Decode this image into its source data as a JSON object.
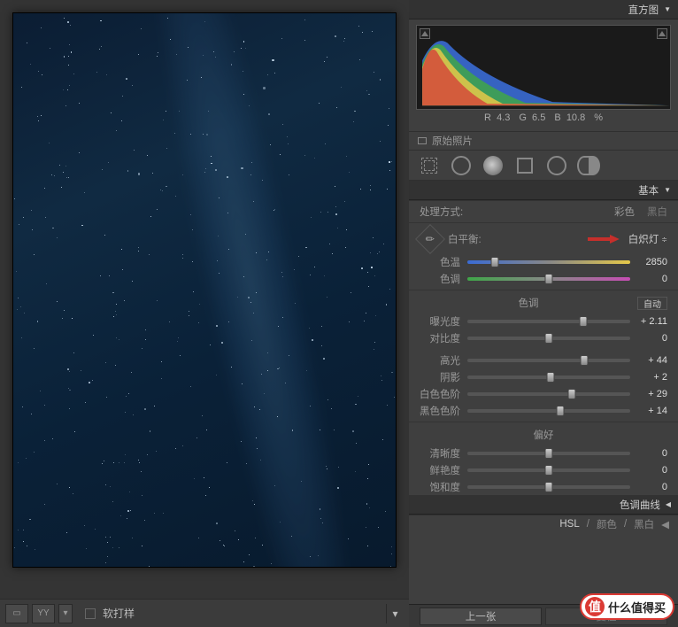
{
  "panels": {
    "histogram": "直方图",
    "basic": "基本",
    "tonecurve": "色调曲线"
  },
  "histogram_readout": {
    "r_label": "R",
    "r_value": "4.3",
    "g_label": "G",
    "g_value": "6.5",
    "b_label": "B",
    "b_value": "10.8",
    "pct": "%"
  },
  "original_photo": "原始照片",
  "treatment": {
    "label": "处理方式:",
    "color": "彩色",
    "bw": "黑白"
  },
  "wb": {
    "label": "白平衡:",
    "preset": "白炽灯"
  },
  "temperature": {
    "label": "色温",
    "value": "2850"
  },
  "tint": {
    "label": "色调",
    "value": "0"
  },
  "tone_section": "色调",
  "auto": "自动",
  "exposure": {
    "label": "曝光度",
    "value": "+ 2.11"
  },
  "contrast": {
    "label": "对比度",
    "value": "0"
  },
  "highlights": {
    "label": "高光",
    "value": "+ 44"
  },
  "shadows": {
    "label": "阴影",
    "value": "+ 2"
  },
  "whites": {
    "label": "白色色阶",
    "value": "+ 29"
  },
  "blacks": {
    "label": "黑色色阶",
    "value": "+ 14"
  },
  "presence_section": "偏好",
  "clarity": {
    "label": "清晰度",
    "value": "0"
  },
  "vibrance": {
    "label": "鲜艳度",
    "value": "0"
  },
  "saturation": {
    "label": "饱和度",
    "value": "0"
  },
  "hsl": {
    "hsl": "HSL",
    "color": "颜色",
    "bw": "黑白"
  },
  "nav": {
    "prev": "上一张",
    "reset": "复位"
  },
  "softproof": "软打样",
  "badge": "什么值得买",
  "chart_data": {
    "type": "histogram",
    "title": "直方图",
    "channels": [
      "R",
      "G",
      "B"
    ],
    "readout": {
      "R": 4.3,
      "G": 6.5,
      "B": 10.8,
      "unit": "%"
    },
    "note": "RGB histogram of image; distribution heavily weighted to shadows, blue channel extends furthest right"
  }
}
